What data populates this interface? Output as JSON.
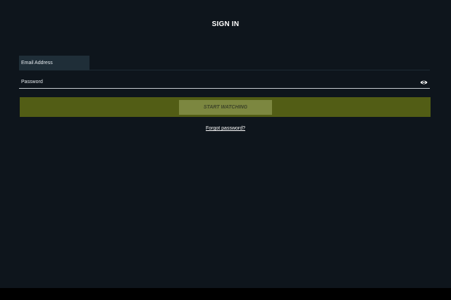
{
  "signin": {
    "title": "SIGN IN",
    "email_label": "Email Address",
    "password_label": "Password",
    "submit_label": "START WATCHING",
    "forgot_label": "Forgot password?"
  },
  "icons": {
    "password_toggle": "eye-icon"
  },
  "colors": {
    "background": "#0e151c",
    "cta_bar": "#525d15",
    "cta_button": "#7c8740",
    "field_focus": "#1f2e38"
  }
}
